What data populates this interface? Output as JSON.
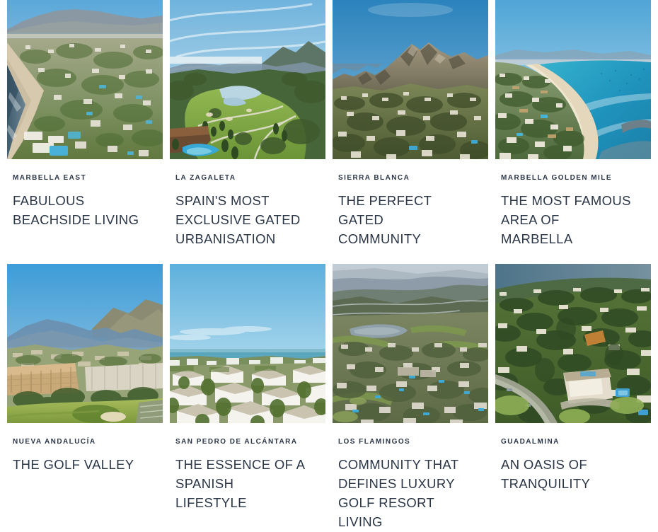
{
  "page": {
    "title": "Marbella Areas Grid",
    "background_color": "#ffffff",
    "text_color": "#2b3647"
  },
  "grid": {
    "columns": 4,
    "rows": 2,
    "cards": [
      {
        "id": "marbella-east",
        "kicker": "MARBELLA EAST",
        "title": "FABULOUS BEACHSIDE LIVING",
        "image_alt": "Aerial view of beachside villas and the Mediterranean coast at Marbella East",
        "image_style": "coast-beach",
        "colors": {
          "sky": "#77b6de",
          "sky_low": "#c5dced",
          "mountain": "#8f9ba3",
          "land": "#8f9e6b",
          "sand": "#d9cbb2",
          "sea": "#54707f"
        }
      },
      {
        "id": "la-zagaleta",
        "kicker": "LA ZAGALETA",
        "title": "SPAIN'S MOST EXCLUSIVE GATED URBANISATION",
        "image_alt": "Golf course valley with lake and pointed mountain peak at La Zagaleta",
        "image_style": "golf-valley",
        "colors": {
          "sky": "#8ec0dd",
          "cloud": "#eef3f6",
          "peak": "#6b7e73",
          "fairway": "#8ab24a",
          "lake": "#b9d4e0",
          "forest": "#3f5a33"
        }
      },
      {
        "id": "sierra-blanca",
        "kicker": "SIERRA BLANCA",
        "title": "THE PERFECT GATED COMMUNITY",
        "image_alt": "La Concha mountain rising above the gated community of Sierra Blanca",
        "image_style": "mountain",
        "colors": {
          "sky": "#3e8fc4",
          "mountain": "#9a8d78",
          "mountain_shadow": "#5f5a4c",
          "slope": "#6c7a53",
          "villas": "#cfc7b4"
        }
      },
      {
        "id": "marbella-golden-mile",
        "kicker": "MARBELLA GOLDEN MILE",
        "title": "THE MOST FAMOUS AREA OF MARBELLA",
        "image_alt": "Turquoise sea and curving sandy beach along the Marbella Golden Mile",
        "image_style": "turquoise-bay",
        "colors": {
          "sky": "#68b2dc",
          "sea": "#29a4c4",
          "sea_deep": "#1f7fa6",
          "sand": "#e3d6bd",
          "green": "#5d7a4a"
        }
      },
      {
        "id": "nueva-andalucia",
        "kicker": "NUEVA ANDALUCÍA",
        "title": "THE GOLF VALLEY",
        "image_alt": "Golf Valley of Nueva Andalucía with apartments and distant blue mountains",
        "image_style": "golf-apartments",
        "colors": {
          "sky": "#4fa3da",
          "mountain_far": "#6d8fae",
          "mountain_near": "#8a8a72",
          "buildings": "#c9a978",
          "green": "#9ab356"
        }
      },
      {
        "id": "san-pedro-de-alcantara",
        "kicker": "SAN PEDRO DE ALCÁNTARA",
        "title": "THE ESSENCE OF A SPANISH LIFESTYLE",
        "image_alt": "White Andalusian rooftops of San Pedro de Alcántara with the sea beyond",
        "image_style": "white-village",
        "colors": {
          "sky": "#7cc0e0",
          "sky_low": "#cfe6ef",
          "sea": "#5aa6bd",
          "roofs": "#efeeea",
          "green": "#6f8a4a"
        }
      },
      {
        "id": "los-flamingos",
        "kicker": "LOS FLAMINGOS",
        "title": "COMMUNITY THAT DEFINES LUXURY GOLF RESORT LIVING",
        "image_alt": "Aerial view over Los Flamingos golf resort with lake and distant coastline",
        "image_style": "resort-aerial",
        "colors": {
          "haze": "#b9c3cc",
          "sea": "#9aa9b4",
          "lake": "#8fa0a8",
          "land": "#6f7a56",
          "villas": "#d6d2c6"
        }
      },
      {
        "id": "guadalmina",
        "kicker": "GUADALMINA",
        "title": "AN OASIS OF TRANQUILITY",
        "image_alt": "Leafy villa neighbourhood of Guadalmina beside the sea at golden hour",
        "image_style": "leafy-villas",
        "colors": {
          "sea": "#5c7f96",
          "canopy": "#46612f",
          "villa": "#e8e3d6",
          "pool": "#3f9fd0",
          "lawn": "#8fae55"
        }
      }
    ]
  }
}
